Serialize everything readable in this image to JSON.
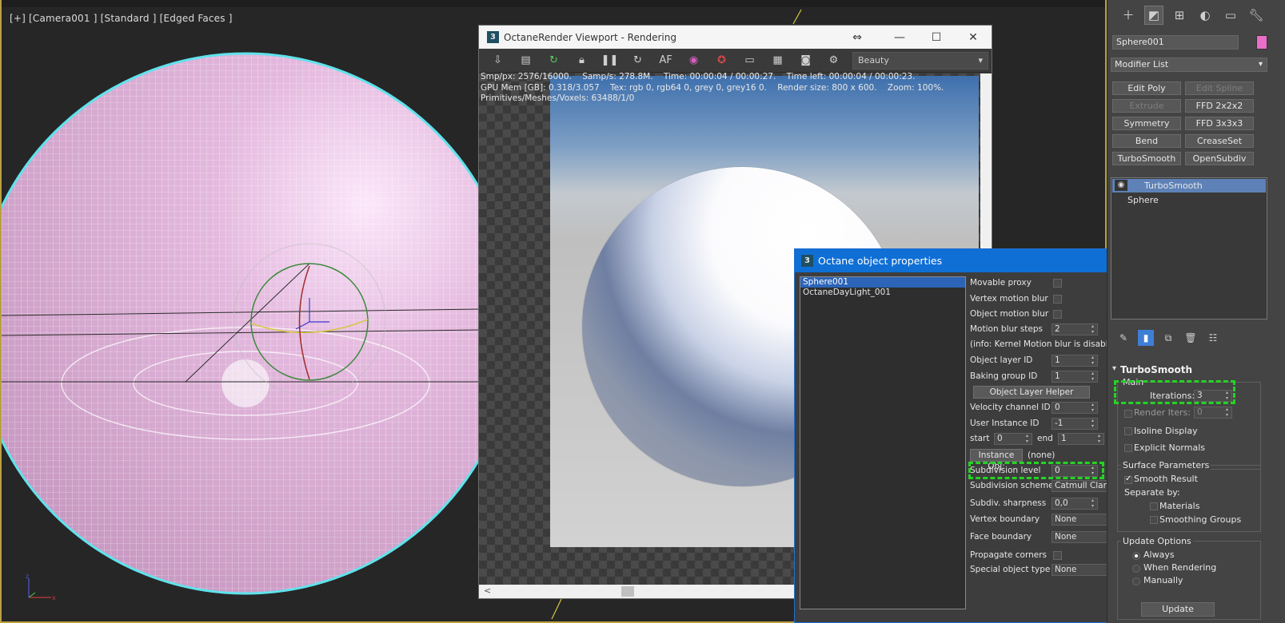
{
  "viewport": {
    "label": "[+] [Camera001 ] [Standard ] [Edged Faces ]",
    "axis": {
      "x": "x",
      "y": "y",
      "z": "z"
    }
  },
  "render_window": {
    "title": "OctaneRender Viewport - Rendering",
    "app_badge": "3",
    "controls": {
      "minimize": "—",
      "maximize": "☐",
      "close": "✕",
      "resize": "⇔"
    },
    "pass_select": "Beauty",
    "stats": {
      "line1": "Smp/px: 2576/16000.    Samp/s: 278.8M.    Time: 00:00:04 / 00:00:27.    Time left: 00:00:04 / 00:00:23.",
      "line2": "GPU Mem [GB]: 0.318/3.057    Tex: rgb 0, rgb64 0, grey 0, grey16 0.    Render size: 800 x 600.    Zoom: 100%.",
      "line3": "Primitives/Meshes/Voxels: 63488/1/0"
    },
    "scroll_left": "<"
  },
  "oop": {
    "title": "Octane object properties",
    "app_badge": "3",
    "close": "✕",
    "objects": [
      {
        "name": "Sphere001",
        "selected": true
      },
      {
        "name": "OctaneDayLight_001",
        "selected": false
      }
    ],
    "props": {
      "movable_proxy": "Movable proxy",
      "vertex_motion_blur": "Vertex motion blur",
      "object_motion_blur": "Object motion blur",
      "motion_blur_steps": {
        "label": "Motion blur steps",
        "value": "2"
      },
      "info": "(info: Kernel Motion blur is disabled.)",
      "object_layer_id": {
        "label": "Object layer ID",
        "value": "1"
      },
      "baking_group_id": {
        "label": "Baking group ID",
        "value": "1"
      },
      "object_layer_helper": "Object Layer Helper",
      "velocity_channel_id": {
        "label": "Velocity channel ID",
        "value": "0"
      },
      "user_instance_id": {
        "label": "User Instance ID",
        "value": "-1"
      },
      "start": {
        "label": "start",
        "value": "0"
      },
      "end": {
        "label": "end",
        "value": "1"
      },
      "dots": "...",
      "instance_obj": {
        "button": "Instance Obj:",
        "value": "(none)"
      },
      "subdivision_level": {
        "label": "Subdivision level",
        "value": "0"
      },
      "subdivision_scheme": {
        "label": "Subdivision scheme",
        "value": "Catmull Clark"
      },
      "subdiv_sharpness": {
        "label": "Subdiv. sharpness",
        "value": "0,0"
      },
      "vertex_boundary": {
        "label": "Vertex boundary",
        "value": "None"
      },
      "face_boundary": {
        "label": "Face boundary",
        "value": "None"
      },
      "propagate_corners": "Propagate corners",
      "special_object_type": {
        "label": "Special object type",
        "value": "None"
      }
    }
  },
  "command_panel": {
    "tabs": [
      "create-icon",
      "modify-icon",
      "hierarchy-icon",
      "motion-icon",
      "display-icon",
      "utilities-icon"
    ],
    "object_name": "Sphere001",
    "object_color": "#e96ec8",
    "modifier_list": "Modifier List",
    "modifier_buttons": [
      {
        "label": "Edit Poly",
        "enabled": true
      },
      {
        "label": "Edit Spline",
        "enabled": false
      },
      {
        "label": "Extrude",
        "enabled": false
      },
      {
        "label": "FFD 2x2x2",
        "enabled": true
      },
      {
        "label": "Symmetry",
        "enabled": true
      },
      {
        "label": "FFD 3x3x3",
        "enabled": true
      },
      {
        "label": "Bend",
        "enabled": true
      },
      {
        "label": "CreaseSet",
        "enabled": true
      },
      {
        "label": "TurboSmooth",
        "enabled": true
      },
      {
        "label": "OpenSubdiv",
        "enabled": true
      }
    ],
    "stack": [
      {
        "label": "TurboSmooth",
        "selected": true
      },
      {
        "label": "Sphere",
        "selected": false
      }
    ],
    "turbosmooth": {
      "title": "TurboSmooth",
      "main_group": "Main",
      "iterations": {
        "label": "Iterations:",
        "value": "3"
      },
      "render_iters": {
        "label": "Render Iters:",
        "value": "0"
      },
      "isoline_display": "Isoline Display",
      "explicit_normals": "Explicit Normals",
      "surface_group": "Surface Parameters",
      "smooth_result": "Smooth Result",
      "separate_by": "Separate by:",
      "materials": "Materials",
      "smoothing_groups": "Smoothing Groups",
      "update_group": "Update Options",
      "always": "Always",
      "when_rendering": "When Rendering",
      "manually": "Manually",
      "update_button": "Update"
    }
  },
  "colors": {
    "viewport_border": "#b9a040",
    "sphere_fill": "#e2b8dc",
    "sphere_outline": "#5fe3ec",
    "dialog_accent": "#0f6fd5",
    "highlight": "#25d325"
  }
}
